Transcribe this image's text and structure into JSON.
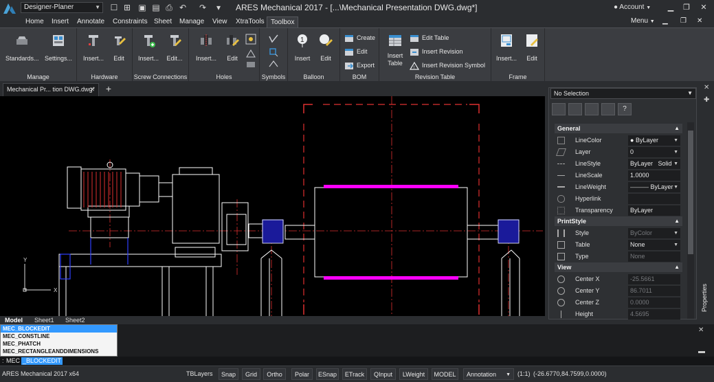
{
  "titlebar": {
    "workspace": "Designer-Planer",
    "title": "ARES Mechanical 2017 - [...\\Mechanical Presentation DWG.dwg*]",
    "account": "Account",
    "qat_icons": [
      "new-icon",
      "open-icon",
      "save-icon",
      "save-as-icon",
      "print-icon",
      "undo-icon",
      "redo-icon",
      "customize-icon"
    ]
  },
  "tabs": [
    "Home",
    "Insert",
    "Annotate",
    "Constraints",
    "Sheet",
    "Manage",
    "View",
    "XtraTools",
    "Toolbox"
  ],
  "active_tab": "Toolbox",
  "menu_label": "Menu",
  "ribbon": {
    "manage": {
      "title": "Manage",
      "standards": "Standards...",
      "settings": "Settings..."
    },
    "hardware": {
      "title": "Hardware",
      "insert": "Insert...",
      "edit": "Edit"
    },
    "screw": {
      "title": "Screw Connections",
      "insert": "Insert...",
      "edit": "Edit..."
    },
    "holes": {
      "title": "Holes",
      "insert": "Insert...",
      "edit": "Edit"
    },
    "symbols": {
      "title": "Symbols"
    },
    "balloon": {
      "title": "Balloon",
      "insert": "Insert",
      "edit": "Edit"
    },
    "bom": {
      "title": "BOM",
      "create": "Create",
      "edit": "Edit",
      "export": "Export"
    },
    "revision": {
      "title": "Revision Table",
      "insert_table_1": "Insert",
      "insert_table_2": "Table",
      "edit_table": "Edit Table",
      "insert_revision": "Insert Revision",
      "insert_revision_symbol": "Insert Revision Symbol"
    },
    "frame": {
      "title": "Frame",
      "insert": "Insert...",
      "edit": "Edit"
    }
  },
  "document": {
    "tab": "Mechanical Pr... tion DWG.dwg*"
  },
  "sheets": [
    "Model",
    "Sheet1",
    "Sheet2"
  ],
  "properties": {
    "selection": "No Selection",
    "panel_label": "Properties",
    "groups": {
      "general": "General",
      "printstyle": "PrintStyle",
      "view": "View"
    },
    "general": [
      {
        "name": "LineColor",
        "value": "ByLayer",
        "icon": "color-icon"
      },
      {
        "name": "Layer",
        "value": "0",
        "icon": "layer-icon"
      },
      {
        "name": "LineStyle",
        "value": "ByLayer",
        "extra": "Solid",
        "icon": "linestyle-icon"
      },
      {
        "name": "LineScale",
        "value": "1.0000",
        "icon": "linescale-icon"
      },
      {
        "name": "LineWeight",
        "value": "ByLayer",
        "icon": "lineweight-icon"
      },
      {
        "name": "Hyperlink",
        "value": "",
        "icon": "hyperlink-icon"
      },
      {
        "name": "Transparency",
        "value": "ByLayer",
        "icon": "transparency-icon"
      }
    ],
    "printstyle": [
      {
        "name": "Style",
        "value": "ByColor",
        "icon": "style-icon"
      },
      {
        "name": "Table",
        "value": "None",
        "icon": "table-icon"
      },
      {
        "name": "Type",
        "value": "None",
        "icon": "type-icon"
      }
    ],
    "view": [
      {
        "name": "Center X",
        "value": "-25.5661",
        "icon": "center-x-icon"
      },
      {
        "name": "Center Y",
        "value": "86.7011",
        "icon": "center-y-icon"
      },
      {
        "name": "Center Z",
        "value": "0.0000",
        "icon": "center-z-icon"
      },
      {
        "name": "Height",
        "value": "4.5695",
        "icon": "height-icon"
      }
    ]
  },
  "command": {
    "autocomplete": [
      "MEC_BLOCKEDIT",
      "MEC_CONSTLINE",
      "MEC_PHATCH",
      "MEC_RECTANGLEANDDIMENSIONS"
    ],
    "prompt": ":",
    "typed": "MEC",
    "completion": "_BLOCKEDIT"
  },
  "statusbar": {
    "app": "ARES Mechanical 2017 x64",
    "tblayers": "TBLayers",
    "toggles": [
      "Snap",
      "Grid",
      "Ortho",
      "Polar",
      "ESnap",
      "ETrack",
      "QInput",
      "LWeight",
      "MODEL"
    ],
    "annotation": "Annotation",
    "scale": "(1:1)",
    "coords": "(-26.6770,84.7599,0.0000)"
  }
}
